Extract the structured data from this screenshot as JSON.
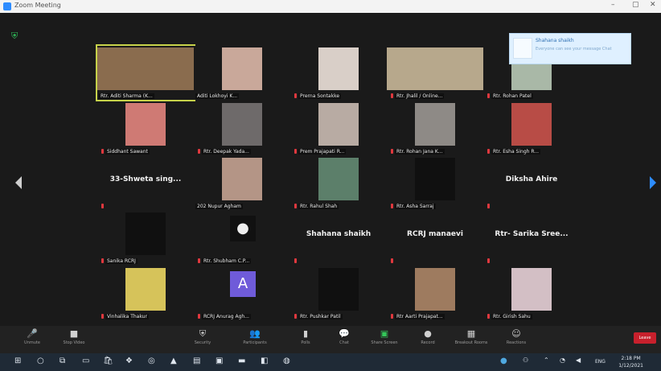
{
  "window": {
    "title": "Zoom Meeting",
    "minimize": "–",
    "maximize": "▢",
    "close": "✕"
  },
  "notification": {
    "name": "Shahana shaikh",
    "message": "Everyone can see your message  Chat"
  },
  "participants": [
    {
      "name": "Rtr. Aditi Sharma (K...",
      "speaking": true,
      "muted": false,
      "bg": "#8a6c4e"
    },
    {
      "name": "Aditi Lokhoyi K...",
      "speaking": false,
      "muted": false,
      "bg": "#c9a89a"
    },
    {
      "name": "Prerna Sontakke",
      "speaking": false,
      "muted": true,
      "bg": "#d9cfc8"
    },
    {
      "name": "Rtr. Jhalil / Online...",
      "speaking": false,
      "muted": true,
      "bg": "#b7a88c"
    },
    {
      "name": "Rtr. Rohan Patel",
      "speaking": false,
      "muted": true,
      "bg": "#a9b8a7"
    },
    {
      "name": "Siddhant Sawant",
      "speaking": false,
      "muted": true,
      "bg": "#cf7a74"
    },
    {
      "name": "Rtr. Deepak Yada...",
      "speaking": false,
      "muted": true,
      "bg": "#6e6a6a"
    },
    {
      "name": "Prem Prajapati R...",
      "speaking": false,
      "muted": true,
      "bg": "#b8aba3"
    },
    {
      "name": "Rtr. Rohan Jana K...",
      "speaking": false,
      "muted": true,
      "bg": "#8e8a86"
    },
    {
      "name": "Rtr. Esha Singh R...",
      "speaking": false,
      "muted": true,
      "bg": "#b84c46"
    },
    {
      "name": "",
      "label": "33-Shweta sing...",
      "speaking": false,
      "muted": true,
      "bg": ""
    },
    {
      "name": "202 Nupur Agham",
      "speaking": false,
      "muted": false,
      "bg": "#b49586"
    },
    {
      "name": "Rtr. Rahul Shah",
      "speaking": false,
      "muted": true,
      "bg": "#5c7f6a"
    },
    {
      "name": "Rtr. Asha Sarraj",
      "speaking": false,
      "muted": true,
      "bg": "#101010"
    },
    {
      "name": "",
      "label": "Diksha Ahire",
      "speaking": false,
      "muted": true,
      "bg": ""
    },
    {
      "name": "Sanika RCRJ",
      "speaking": false,
      "muted": true,
      "bg": "#101010"
    },
    {
      "name": "Rtr. Shubham C.P...",
      "speaking": false,
      "muted": true,
      "bg": "avatar"
    },
    {
      "name": "",
      "label": "Shahana shaikh",
      "speaking": false,
      "muted": true,
      "bg": ""
    },
    {
      "name": "",
      "label": "RCRJ manaevi",
      "speaking": false,
      "muted": true,
      "bg": ""
    },
    {
      "name": "",
      "label": "Rtr- Sarika Sree...",
      "speaking": false,
      "muted": true,
      "bg": ""
    },
    {
      "name": "Vinhalika Thakur",
      "speaking": false,
      "muted": true,
      "bg": "#d6c35a"
    },
    {
      "name": "RCRJ Anurag Agh...",
      "speaking": false,
      "muted": true,
      "bg": "letter",
      "letter": "A"
    },
    {
      "name": "Rtr. Pushkar Patil",
      "speaking": false,
      "muted": true,
      "bg": "#101010"
    },
    {
      "name": "Rtr Aarti Prajapat...",
      "speaking": false,
      "muted": true,
      "bg": "#9e7b5f"
    },
    {
      "name": "Rtr. Girish Sahu",
      "speaking": false,
      "muted": true,
      "bg": "#d3bfc5"
    }
  ],
  "toolbar": {
    "items": [
      {
        "icon": "🎤",
        "label": "Unmute"
      },
      {
        "icon": "■",
        "label": "Stop Video"
      },
      {
        "icon": "⛨",
        "label": "Security"
      },
      {
        "icon": "👥",
        "label": "Participants"
      },
      {
        "icon": "▮",
        "label": "Polls"
      },
      {
        "icon": "💬",
        "label": "Chat"
      },
      {
        "icon": "▣",
        "label": "Share Screen"
      },
      {
        "icon": "●",
        "label": "Record"
      },
      {
        "icon": "▦",
        "label": "Breakout Rooms"
      },
      {
        "icon": "☺",
        "label": "Reactions"
      }
    ],
    "leave": "Leave"
  },
  "taskbar": {
    "language": "ENG",
    "time": "2:18 PM",
    "date": "1/12/2021"
  }
}
